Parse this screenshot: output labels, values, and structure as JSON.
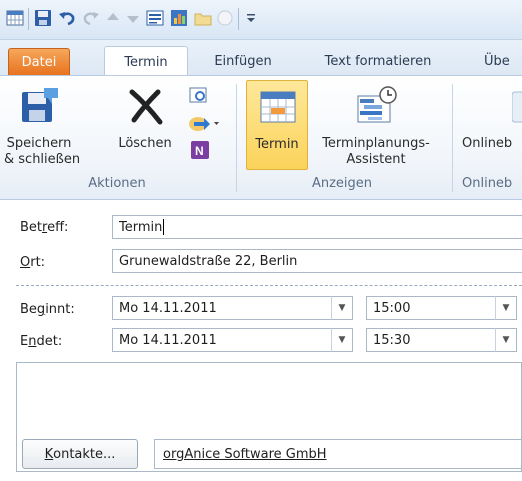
{
  "qat": {
    "icons": [
      "calendar-app-icon",
      "save-icon",
      "undo-icon",
      "redo-icon",
      "up-arrow-icon",
      "down-arrow-icon",
      "form-icon",
      "chart-icon",
      "folder-icon",
      "circle-icon",
      "customize-icon"
    ]
  },
  "tabs": [
    {
      "label": "Datei"
    },
    {
      "label": "Termin"
    },
    {
      "label": "Einfügen"
    },
    {
      "label": "Text formatieren"
    },
    {
      "label": "Übe"
    }
  ],
  "ribbon": {
    "save_close_line1": "Speichern",
    "save_close_line2": "& schließen",
    "delete": "Löschen",
    "group_actions": "Aktionen",
    "appointment": "Termin",
    "scheduling_line1": "Terminplanungs-",
    "scheduling_line2": "Assistent",
    "group_show": "Anzeigen",
    "online_label": "Onlineb",
    "online_group": "Onlineb"
  },
  "form": {
    "subject_label_pre": "Bet",
    "subject_label_u": "r",
    "subject_label_post": "eff:",
    "subject_value": "Termin",
    "location_label_u": "O",
    "location_label_post": "rt:",
    "location_value": "Grunewaldstraße 22, Berlin",
    "start_label_pre": "Be",
    "start_label_u": "g",
    "start_label_post": "innt:",
    "start_date": "Mo 14.11.2011",
    "start_time": "15:00",
    "end_label_pre": "E",
    "end_label_u": "n",
    "end_label_post": "det:",
    "end_date": "Mo 14.11.2011",
    "end_time": "15:30",
    "contacts_button_pre": "",
    "contacts_button_u": "K",
    "contacts_button_post": "ontakte...",
    "contact_value": "orgAnice Software GmbH"
  },
  "colors": {
    "file_tab": "#e7731f",
    "selected_button": "#fbd35b",
    "ribbon_border": "#b8cbe2"
  }
}
